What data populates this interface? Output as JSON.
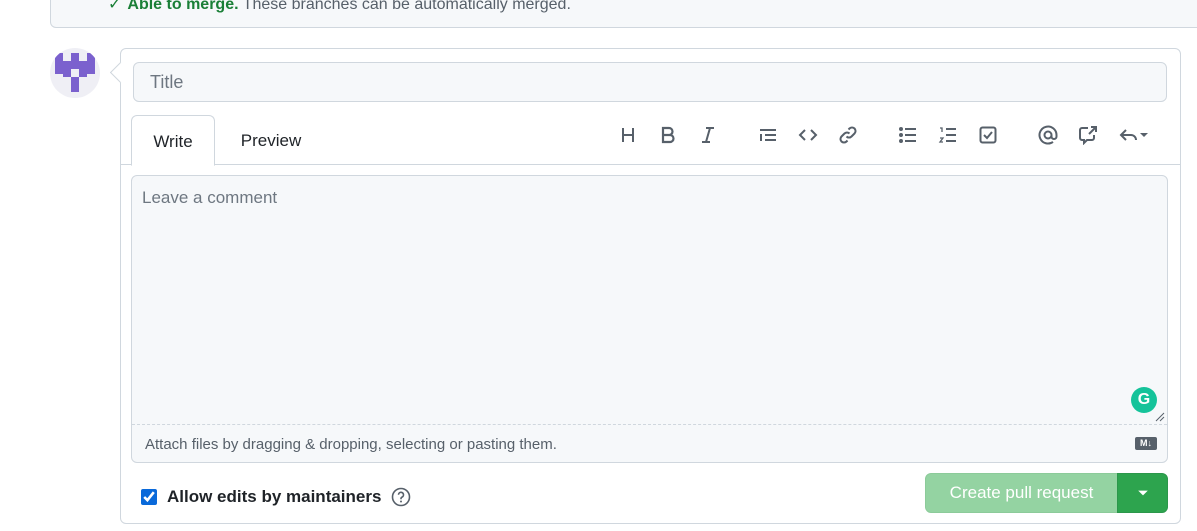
{
  "merge_status": {
    "status": "Able to merge.",
    "message": "These branches can be automatically merged.",
    "icon": "check-icon"
  },
  "composer": {
    "title_placeholder": "Title",
    "tabs": [
      {
        "label": "Write",
        "active": true
      },
      {
        "label": "Preview",
        "active": false
      }
    ],
    "toolbar": [
      "heading-icon",
      "bold-icon",
      "italic-icon",
      "quote-icon",
      "code-icon",
      "link-icon",
      "unordered-list-icon",
      "ordered-list-icon",
      "task-list-icon",
      "mention-icon",
      "cross-reference-icon",
      "saved-replies-icon"
    ],
    "comment_placeholder": "Leave a comment",
    "attach_text": "Attach files by dragging & dropping, selecting or pasting them.",
    "markdown_badge": "M↓",
    "grammarly_badge": "G"
  },
  "options": {
    "allow_edits_label": "Allow edits by maintainers",
    "allow_edits_checked": true
  },
  "actions": {
    "create_label": "Create pull request"
  },
  "colors": {
    "green": "#2da44e",
    "green_disabled": "#94d3a2",
    "merge_ok": "#1a7f37",
    "grammarly": "#15c39a"
  }
}
